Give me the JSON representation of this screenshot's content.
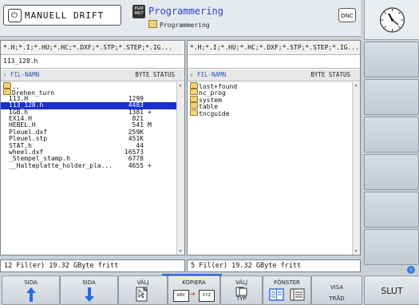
{
  "header": {
    "mode_title": "MANUELL DRIFT",
    "program_icon_text": "PGM MGT",
    "program_title": "Programmering",
    "program_subtitle": "Programmering",
    "dnc_label": "DNC"
  },
  "left_pane": {
    "filter": "*.H;*.I;*.HU;*.HC;*.DXF;*.STP;*.STEP;*.IG...",
    "path": "113_128.h",
    "col_name": "FIL-NAMN",
    "col_status": "BYTE STATUS",
    "rows": [
      {
        "name": "..",
        "size": "",
        "status": "",
        "type": "folder"
      },
      {
        "name": "Drehen_turn",
        "size": "",
        "status": "",
        "type": "folder"
      },
      {
        "name": "113.H",
        "size": "1299",
        "status": "",
        "type": "file"
      },
      {
        "name": "113_128.h",
        "size": "4483",
        "status": "",
        "type": "file",
        "selected": true
      },
      {
        "name": "1GB.h",
        "size": "1381",
        "status": "+",
        "type": "file"
      },
      {
        "name": "EX14.H",
        "size": "821",
        "status": "",
        "type": "file"
      },
      {
        "name": "HEBEL.H",
        "size": "541",
        "status": "M",
        "type": "file"
      },
      {
        "name": "Pleuel.dxf",
        "size": "259K",
        "status": "",
        "type": "file"
      },
      {
        "name": "Pleuel.stp",
        "size": "451K",
        "status": "",
        "type": "file"
      },
      {
        "name": "STAT.h",
        "size": "44",
        "status": "",
        "type": "file"
      },
      {
        "name": "wheel.dxf",
        "size": "16573",
        "status": "",
        "type": "file"
      },
      {
        "name": "_Stempel_stamp.h",
        "size": "6778",
        "status": "",
        "type": "file"
      },
      {
        "name": "__Halteplatte_holder_pla...",
        "size": "4655",
        "status": "+",
        "type": "file"
      }
    ],
    "status_line": "12 Fil(er)  19.32 GByte fritt"
  },
  "right_pane": {
    "filter": "*.H;*.I;*.HU;*.HC;*.DXF;*.STP;*.STEP;*.IG...",
    "path": "",
    "col_name": "FIL-NAMN",
    "col_status": "BYTE STATUS",
    "rows": [
      {
        "name": "lost+found",
        "type": "folder"
      },
      {
        "name": "nc_prog",
        "type": "folder"
      },
      {
        "name": "system",
        "type": "folder"
      },
      {
        "name": "table",
        "type": "folder"
      },
      {
        "name": "tncguide",
        "type": "folder"
      }
    ],
    "status_line": "5  Fil(er)  19.32 GByte fritt"
  },
  "softkeys": {
    "sida_up": "SIDA",
    "sida_down": "SIDA",
    "valj": "VÄLJ",
    "kopiera": "KOPIERA",
    "kopiera_icon_left": "ABC",
    "kopiera_icon_right": "XYZ",
    "valj_typ_top": "VÄLJ",
    "valj_typ_bottom": "TYP",
    "fonster": "FÖNSTER",
    "visa_trad_top": "VISA",
    "visa_trad_bottom": "TRÅD",
    "slut": "SLUT"
  },
  "colors": {
    "selection": "#1a2fd1",
    "title_blue": "#2845c7",
    "arrow_blue": "#2a68e0",
    "folder": "#f1d27c"
  },
  "icons": [
    "power-icon",
    "program-management-icon",
    "folder-icon",
    "clock-icon",
    "arrow-up-icon",
    "arrow-down-icon",
    "select-file-icon",
    "copy-icon",
    "file-type-icon",
    "window-split-icon",
    "window-single-icon",
    "info-icon"
  ]
}
